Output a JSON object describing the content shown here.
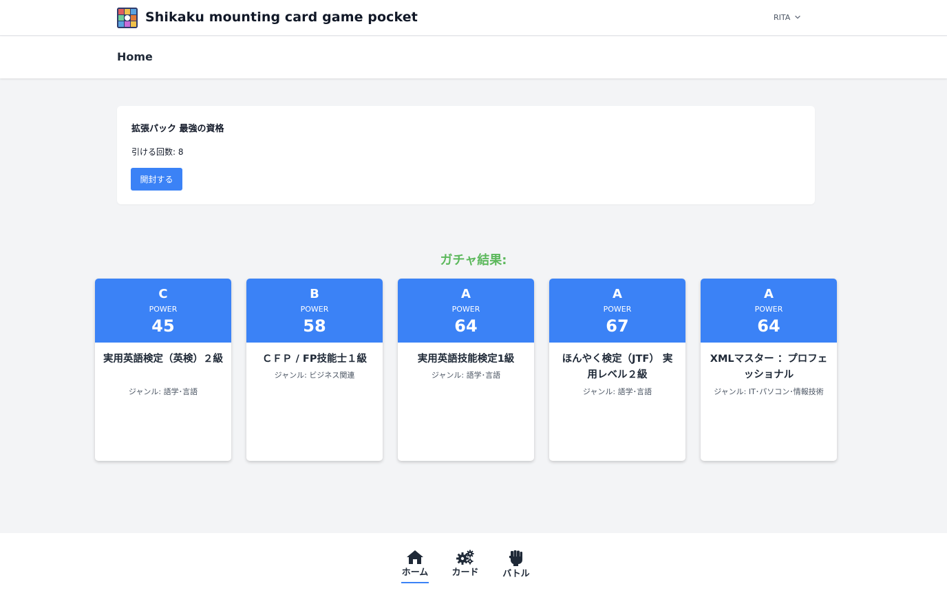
{
  "app": {
    "title": "Shikaku mounting card game pocket",
    "user": "RITA"
  },
  "header": {
    "title": "Home"
  },
  "pack": {
    "title": "拡張パック 最強の資格",
    "count_text": "引ける回数: 8",
    "open_button": "開封する"
  },
  "results": {
    "heading": "ガチャ結果:",
    "power_label": "POWER",
    "cards": [
      {
        "rank": "C",
        "power": "45",
        "name": "実用英語検定（英検）２級",
        "genre": "ジャンル: 語学･言語"
      },
      {
        "rank": "B",
        "power": "58",
        "name": "ＣＦＰ / FP技能士１級",
        "genre": "ジャンル: ビジネス関連"
      },
      {
        "rank": "A",
        "power": "64",
        "name": "実用英語技能検定1級",
        "genre": "ジャンル: 語学･言語"
      },
      {
        "rank": "A",
        "power": "67",
        "name": "ほんやく検定（JTF） 実用レベル２級",
        "genre": "ジャンル: 語学･言語"
      },
      {
        "rank": "A",
        "power": "64",
        "name": "XMLマスター ：プロフェッショナル",
        "genre": "ジャンル: IT･パソコン･情報技術"
      }
    ]
  },
  "bottom_nav": {
    "items": [
      {
        "label": "ホーム",
        "icon": "home-icon",
        "active": true
      },
      {
        "label": "カード",
        "icon": "gears-icon",
        "active": false
      },
      {
        "label": "バトル",
        "icon": "fist-icon",
        "active": false
      }
    ]
  },
  "colors": {
    "accent": "#3b82f6",
    "result_heading": "#5cb85c",
    "background": "#f3f4f6"
  }
}
